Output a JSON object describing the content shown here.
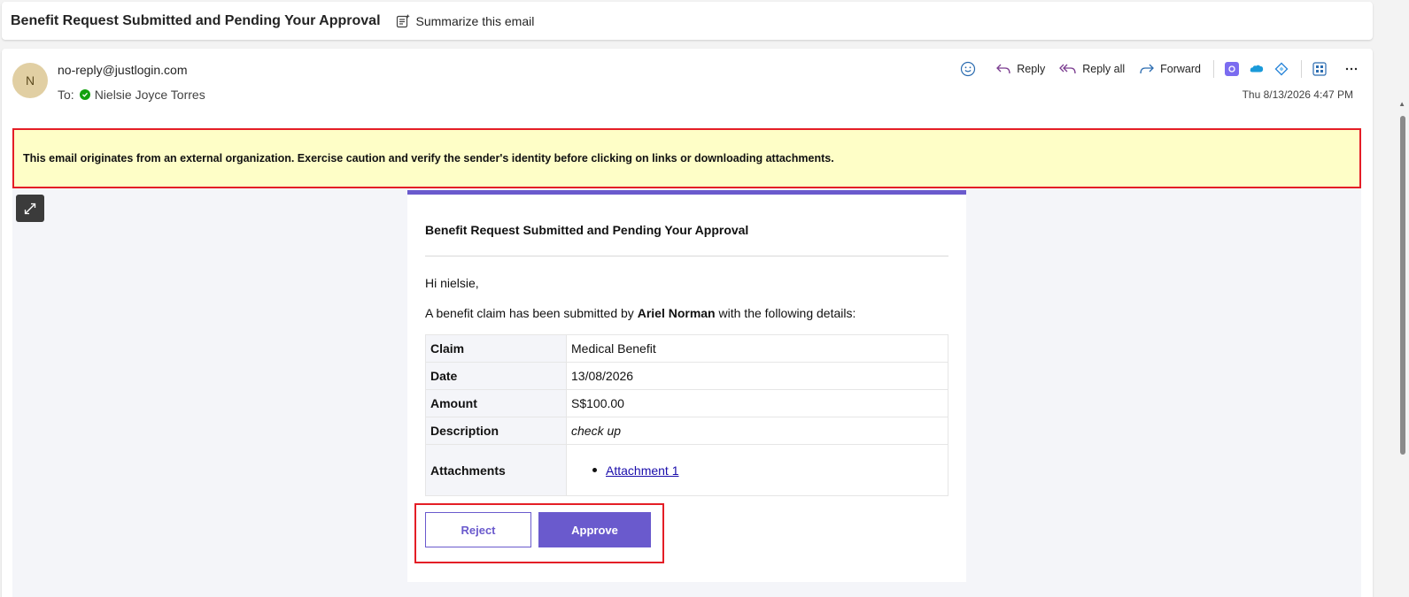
{
  "subject": {
    "title": "Benefit Request Submitted and Pending Your Approval",
    "summarize_label": "Summarize this email"
  },
  "header": {
    "avatar_initial": "N",
    "sender": "no-reply@justlogin.com",
    "to_label": "To:",
    "recipient": "Nielsie Joyce Torres",
    "datetime": "Thu 8/13/2026 4:47 PM",
    "actions": {
      "reply": "Reply",
      "reply_all": "Reply all",
      "forward": "Forward"
    }
  },
  "warning": {
    "text": "This email originates from an external organization. Exercise caution and verify the sender's identity before clicking on links or downloading attachments."
  },
  "email": {
    "title": "Benefit Request Submitted and Pending Your Approval",
    "greeting": "Hi nielsie,",
    "intro_before": "A benefit claim has been submitted by ",
    "intro_name": "Ariel Norman",
    "intro_after": " with the following details:",
    "details": {
      "claim_label": "Claim",
      "claim_value": "Medical Benefit",
      "date_label": "Date",
      "date_value": "13/08/2026",
      "amount_label": "Amount",
      "amount_value": "S$100.00",
      "description_label": "Description",
      "description_value": "check up",
      "attachments_label": "Attachments",
      "attachment_1": "Attachment 1"
    },
    "buttons": {
      "reject": "Reject",
      "approve": "Approve"
    }
  },
  "colors": {
    "accent": "#6a5acd",
    "warning_bg": "#fefec7",
    "warning_border": "#e41e26"
  }
}
